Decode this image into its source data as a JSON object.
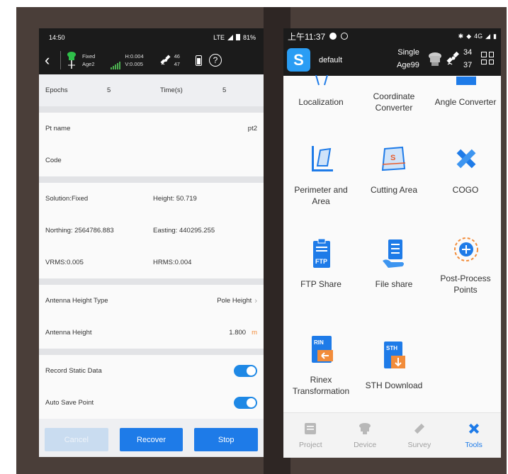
{
  "colors": {
    "accent": "#1e7be8",
    "unit_orange": "#f28c3a",
    "backdrop": "#4a3e39",
    "status_bar": "#1b1b1b"
  },
  "left_phone": {
    "status": {
      "time": "14:50",
      "network": "LTE",
      "battery": "81%"
    },
    "header": {
      "solution": "Fixed",
      "age": "Age2",
      "h_precision": "H:0.004",
      "v_precision": "V:0.005",
      "sats_top": "46",
      "sats_bottom": "47",
      "icons": [
        "back-arrow-icon",
        "rtk-antenna-icon",
        "signal-bars-icon",
        "satellite-icon",
        "battery-icon",
        "help-icon"
      ]
    },
    "epochs_label": "Epochs",
    "epochs_value": "5",
    "time_label": "Time(s)",
    "time_value": "5",
    "pt_name_label": "Pt name",
    "pt_name_value": "pt2",
    "code_label": "Code",
    "solution_text": "Solution:Fixed",
    "height_text": "Height: 50.719",
    "northing_text": "Northing: 2564786.883",
    "easting_text": "Easting: 440295.255",
    "vrms_text": "VRMS:0.005",
    "hrms_text": "HRMS:0.004",
    "antenna_type_label": "Antenna Height Type",
    "antenna_type_value": "Pole Height",
    "antenna_height_label": "Antenna Height",
    "antenna_height_value": "1.800",
    "antenna_height_unit": "m",
    "record_static_label": "Record Static Data",
    "record_static_on": true,
    "auto_save_label": "Auto Save Point",
    "auto_save_on": true,
    "buttons": {
      "cancel": "Cancel",
      "recover": "Recover",
      "stop": "Stop"
    }
  },
  "right_phone": {
    "status": {
      "time": "上午11:37",
      "network": "4G"
    },
    "header": {
      "project": "default",
      "solution": "Single",
      "age": "Age99",
      "sats_top": "34",
      "sats_bottom": "37",
      "icons": [
        "app-logo-icon",
        "receiver-icon",
        "satellite-icon",
        "grid-menu-icon"
      ]
    },
    "tools": [
      {
        "label": "Localization",
        "icon": "localization-icon"
      },
      {
        "label": "Coordinate Converter",
        "icon": "coordinate-converter-icon"
      },
      {
        "label": "Angle Converter",
        "icon": "angle-converter-icon"
      },
      {
        "label": "Perimeter and Area",
        "icon": "perimeter-area-icon"
      },
      {
        "label": "Cutting Area",
        "icon": "cutting-area-icon"
      },
      {
        "label": "COGO",
        "icon": "cogo-icon"
      },
      {
        "label": "FTP Share",
        "icon": "ftp-share-icon",
        "badge": "FTP"
      },
      {
        "label": "File share",
        "icon": "file-share-icon"
      },
      {
        "label": "Post-Process Points",
        "icon": "post-process-icon"
      },
      {
        "label": "Rinex Transformation",
        "icon": "rinex-icon",
        "badge": "RIN"
      },
      {
        "label": "STH Download",
        "icon": "sth-download-icon",
        "badge": "STH"
      }
    ],
    "nav": [
      {
        "label": "Project",
        "icon": "project-icon",
        "active": false
      },
      {
        "label": "Device",
        "icon": "device-icon",
        "active": false
      },
      {
        "label": "Survey",
        "icon": "survey-icon",
        "active": false
      },
      {
        "label": "Tools",
        "icon": "tools-icon",
        "active": true
      }
    ]
  }
}
